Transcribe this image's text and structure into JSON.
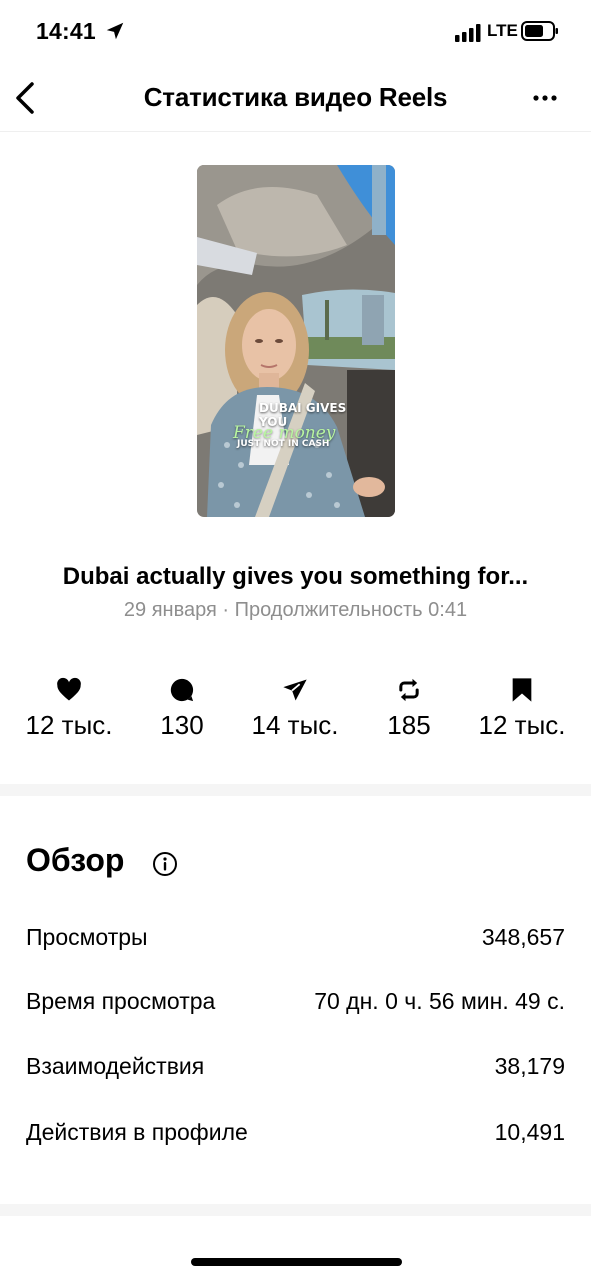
{
  "status": {
    "time": "14:41",
    "network": "LTE"
  },
  "header": {
    "title": "Статистика видео Reels"
  },
  "thumbnail": {
    "caption_line1": "DUBAI GIVES YOU",
    "caption_line2": "Free money",
    "caption_line3": "JUST NOT IN CASH"
  },
  "post": {
    "title": "Dubai actually gives you something for...",
    "meta": "29 января · Продолжительность 0:41"
  },
  "metrics": [
    {
      "icon": "heart-icon",
      "value": "12 тыс."
    },
    {
      "icon": "comment-icon",
      "value": "130"
    },
    {
      "icon": "share-icon",
      "value": "14 тыс."
    },
    {
      "icon": "repost-icon",
      "value": "185"
    },
    {
      "icon": "bookmark-icon",
      "value": "12 тыс."
    }
  ],
  "overview": {
    "title": "Обзор",
    "rows": [
      {
        "label": "Просмотры",
        "value": "348,657"
      },
      {
        "label": "Время просмотра",
        "value": "70 дн. 0 ч. 56 мин. 49 с."
      },
      {
        "label": "Взаимодействия",
        "value": "38,179"
      },
      {
        "label": "Действия в профиле",
        "value": "10,491"
      }
    ]
  },
  "colors": {
    "secondary_text": "#8e8e8e",
    "separator": "#f5f5f5",
    "caption_green": "#b8f5a0"
  }
}
